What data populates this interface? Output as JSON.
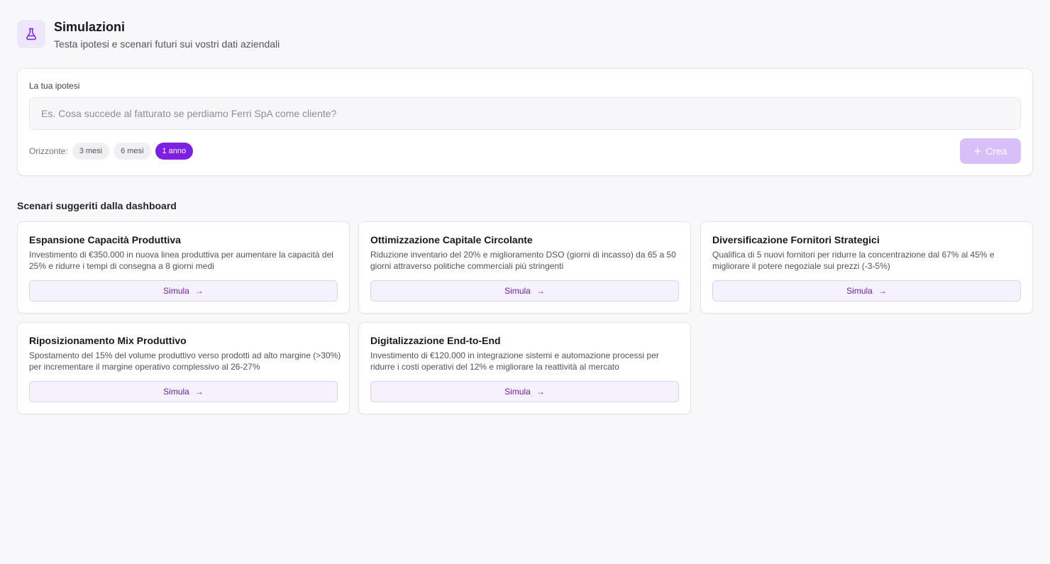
{
  "header": {
    "title": "Simulazioni",
    "subtitle": "Testa ipotesi e scenari futuri sui vostri dati aziendali",
    "icon": "flask-icon",
    "accent": "#7c1fe0"
  },
  "hypothesis": {
    "label": "La tua ipotesi",
    "value": "",
    "placeholder": "Es. Cosa succede al fatturato se perdiamo Ferri SpA come cliente?",
    "horizon_label": "Orizzonte:",
    "horizon_options": [
      "3 mesi",
      "6 mesi",
      "1 anno"
    ],
    "horizon_selected": "1 anno",
    "create_label": "Crea"
  },
  "scenarios": {
    "title": "Scenari suggeriti dalla dashboard",
    "items": [
      {
        "title": "Espansione Capacità Produttiva",
        "description": "Investimento di €350.000 in nuova linea produttiva per aumentare la capacità del 25% e ridurre i tempi di consegna a 8 giorni medi",
        "action": "Simula"
      },
      {
        "title": "Ottimizzazione Capitale Circolante",
        "description": "Riduzione inventario del 20% e miglioramento DSO (giorni di incasso) da 65 a 50 giorni attraverso politiche commerciali più stringenti",
        "action": "Simula"
      },
      {
        "title": "Diversificazione Fornitori Strategici",
        "description": "Qualifica di 5 nuovi fornitori per ridurre la concentrazione dal 67% al 45% e migliorare il potere negoziale sui prezzi (-3-5%)",
        "action": "Simula"
      },
      {
        "title": "Riposizionamento Mix Produttivo",
        "description": "Spostamento del 15% del volume produttivo verso prodotti ad alto margine (>30%) per incrementare il margine operativo complessivo al 26-27%",
        "action": "Simula"
      },
      {
        "title": "Digitalizzazione End-to-End",
        "description": "Investimento di €120.000 in integrazione sistemi e automazione processi per ridurre i costi operativi del 12% e migliorare la reattività al mercato",
        "action": "Simula"
      }
    ]
  }
}
